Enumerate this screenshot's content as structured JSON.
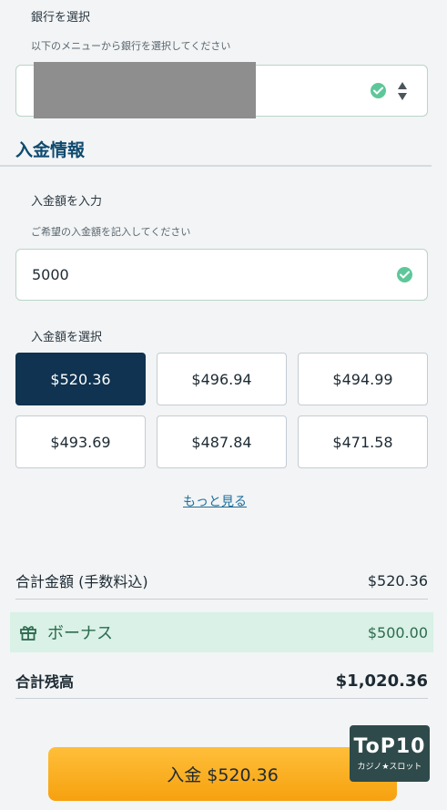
{
  "bank": {
    "label": "銀行を選択",
    "hint": "以下のメニューから銀行を選択してください"
  },
  "deposit": {
    "title": "入金情報",
    "amount_label": "入金額を入力",
    "amount_hint": "ご希望の入金額を記入してください",
    "amount_value": "5000",
    "select_label": "入金額を選択",
    "options": [
      "$520.36",
      "$496.94",
      "$494.99",
      "$493.69",
      "$487.84",
      "$471.58"
    ],
    "selected_index": 0,
    "more_label": "もっと見る"
  },
  "summary": {
    "total_label": "合計金額 (手数料込)",
    "total_value": "$520.36",
    "bonus_label": "ボーナス",
    "bonus_value": "$500.00",
    "balance_label": "合計残高",
    "balance_value": "$1,020.36"
  },
  "cta": {
    "label": "入金 $520.36"
  },
  "badge": {
    "top": "ToP10",
    "bottom": "カジノ★スロット"
  },
  "colors": {
    "accent": "#0f4a6e",
    "selected_button": "#0f3350",
    "check": "#5ec79a",
    "bonus_band": "#d9f1e6",
    "cta": "#f6a10f"
  },
  "icons": [
    "check-icon",
    "sort-arrows-icon",
    "gift-icon"
  ]
}
